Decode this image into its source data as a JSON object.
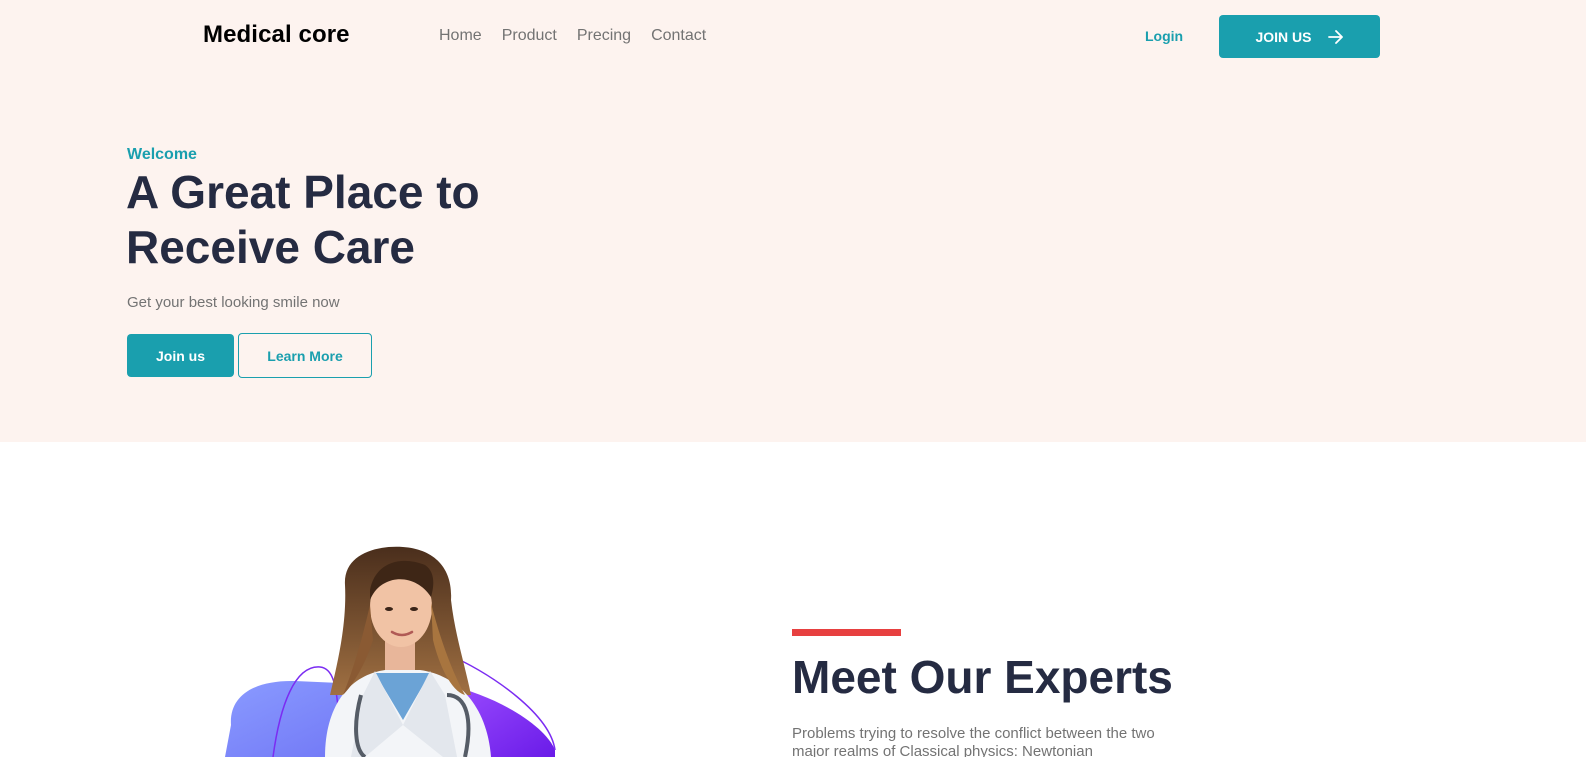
{
  "header": {
    "logo": "Medical core",
    "nav": [
      "Home",
      "Product",
      "Precing",
      "Contact"
    ],
    "login_label": "Login",
    "join_label": "JOIN US"
  },
  "hero": {
    "eyebrow": "Welcome",
    "headline_line1": "A Great Place to",
    "headline_line2": "Receive Care",
    "subtext": "Get your best looking smile now",
    "primary_button": "Join us",
    "secondary_button": "Learn More"
  },
  "experts": {
    "title": "Meet Our Experts",
    "text": "Problems trying to resolve the conflict between the two major realms of Classical physics: Newtonian"
  },
  "colors": {
    "accent": "#1a9fae",
    "hero_background": "#fdf3ef",
    "heading": "#252b42",
    "muted": "#737373",
    "divider_red": "#e74040",
    "blob_blue": "#7b8cff",
    "blob_purple": "#7b2cf2"
  },
  "icons": [
    "arrow-right-icon"
  ]
}
